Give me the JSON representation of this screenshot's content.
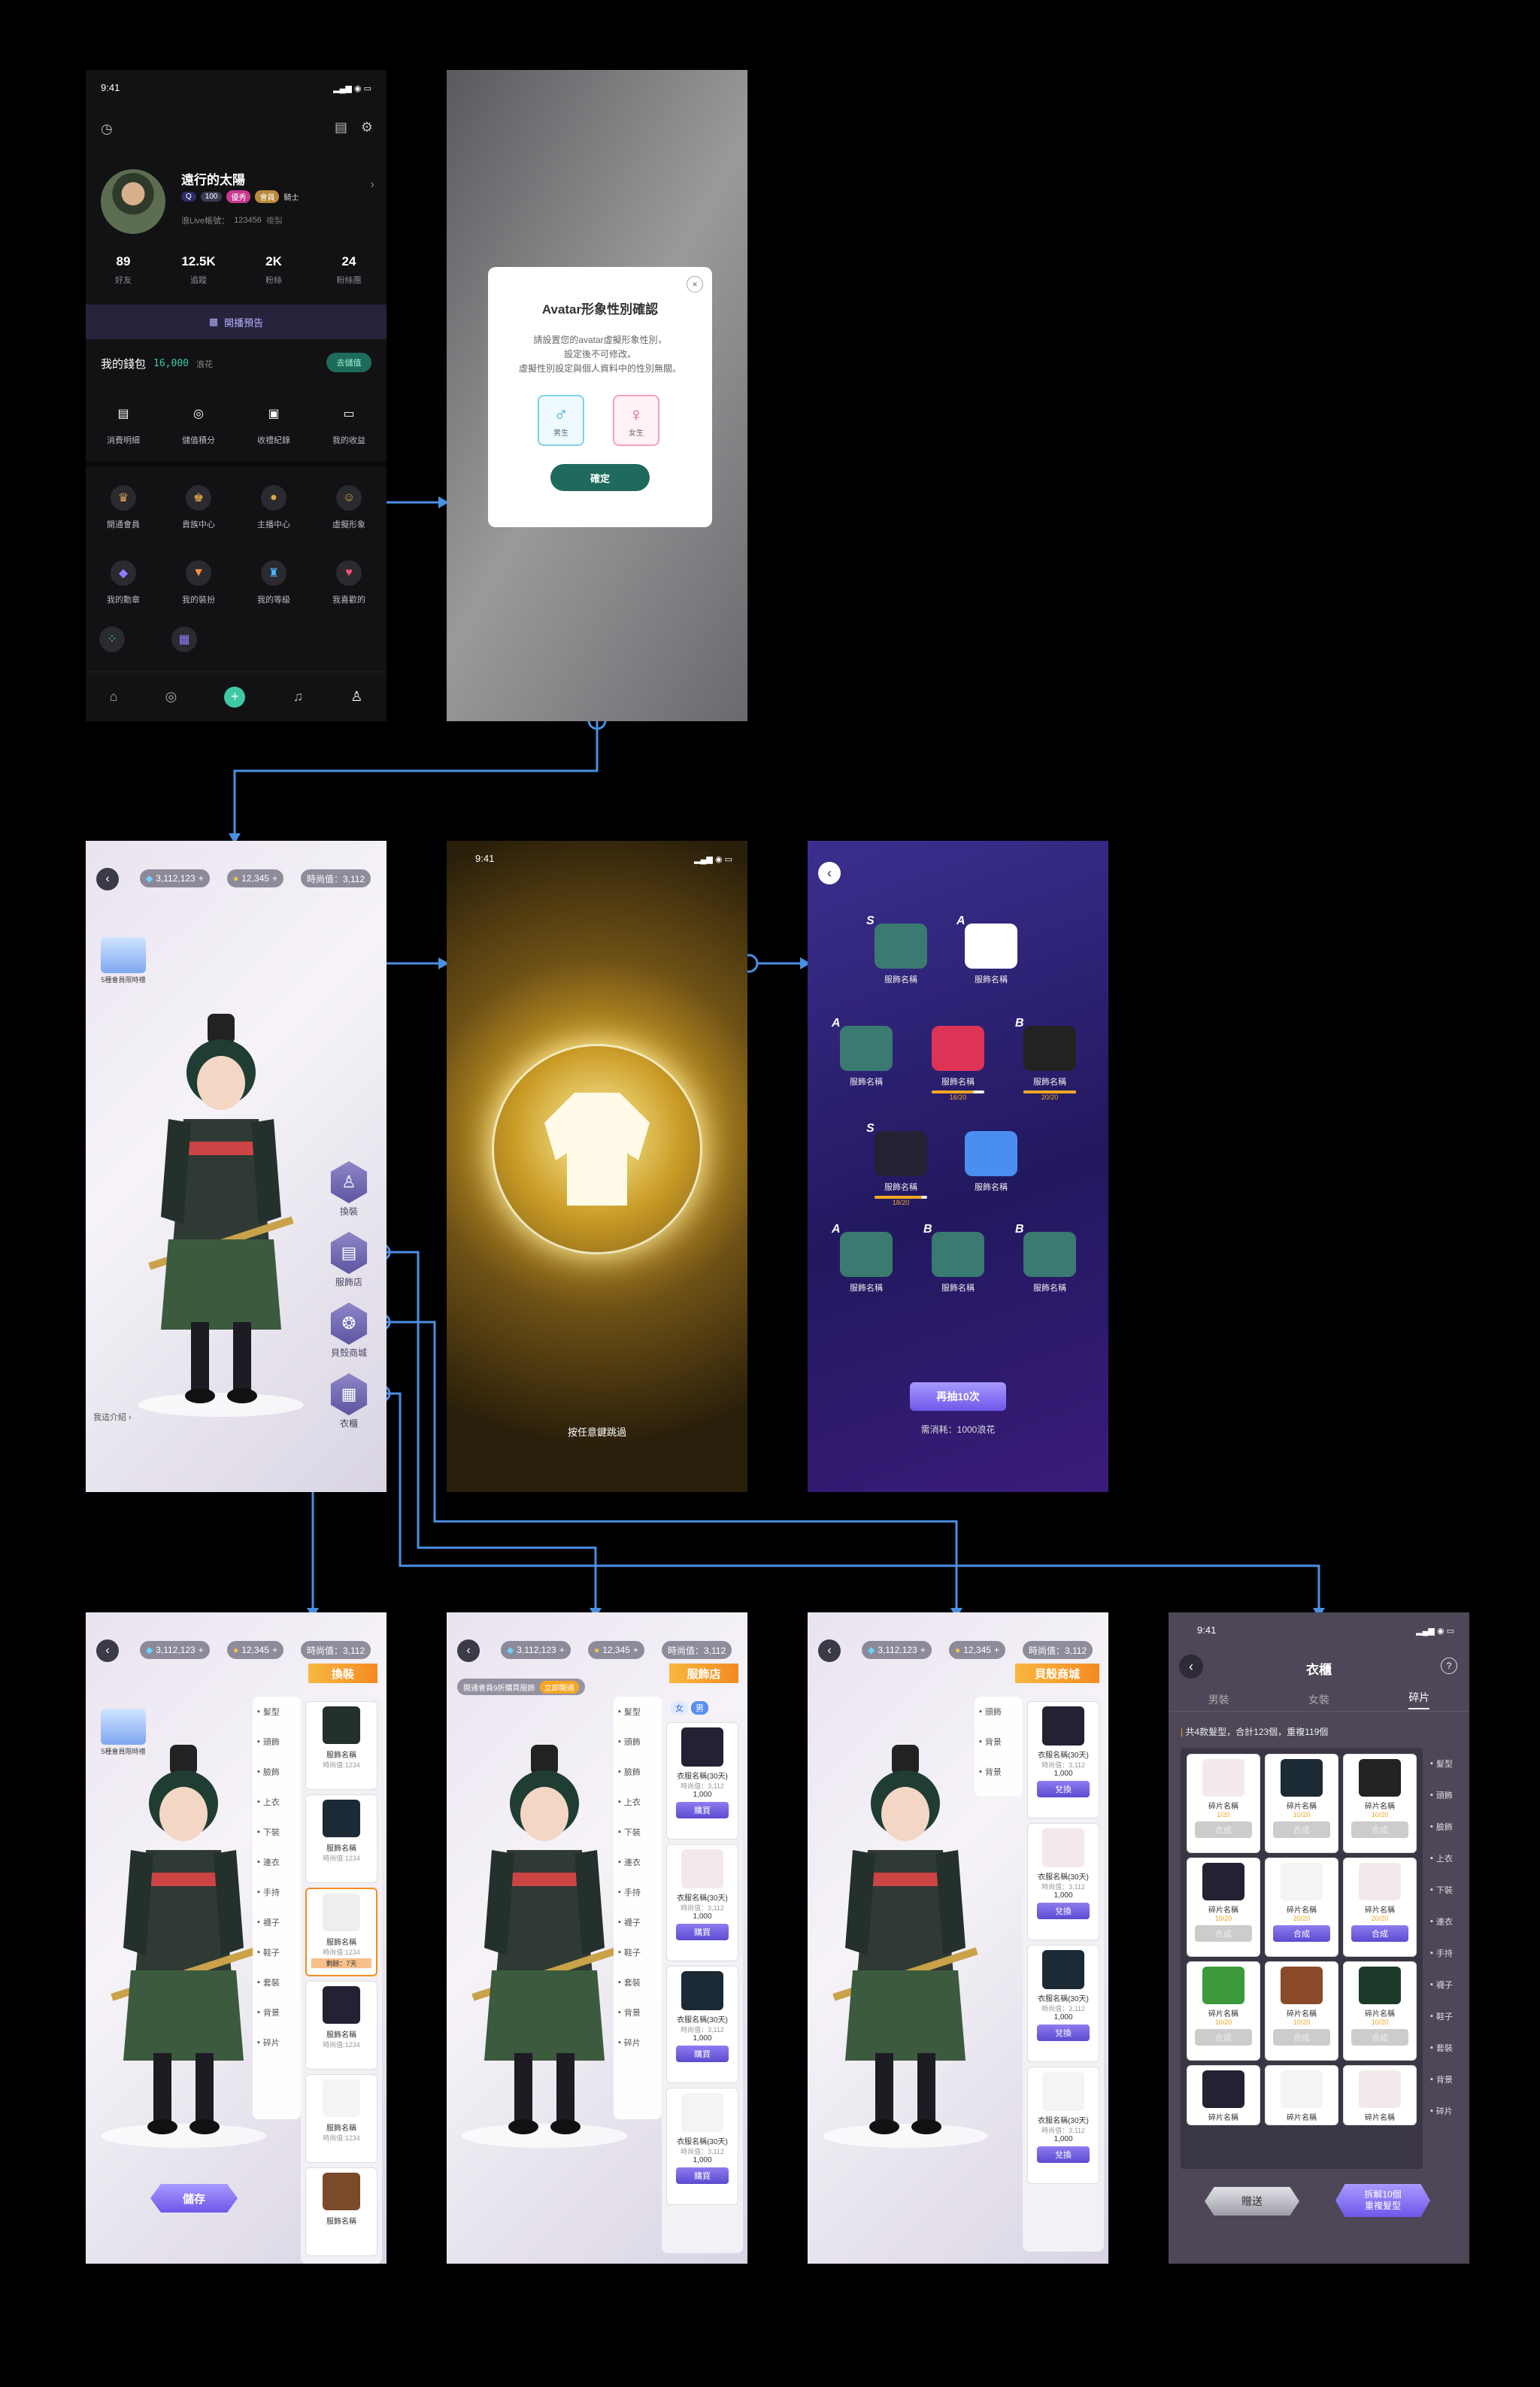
{
  "profile": {
    "time": "9:41",
    "name": "遠行的太陽",
    "level": "100",
    "badge1": "優秀",
    "badge2": "會員",
    "badge3": "騎士",
    "uid_label": "浪Live帳號：",
    "uid": "123456",
    "copy": "複製",
    "stats": [
      {
        "n": "89",
        "l": "好友"
      },
      {
        "n": "12.5K",
        "l": "追蹤"
      },
      {
        "n": "2K",
        "l": "粉絲"
      },
      {
        "n": "24",
        "l": "粉絲團"
      }
    ],
    "live_notice": "開播預告",
    "wallet_label": "我的錢包",
    "wallet_value": "16,000",
    "wallet_unit": "浪花",
    "topup": "去儲值",
    "wallet_items": [
      "消費明細",
      "儲值積分",
      "收禮紀錄",
      "我的收益"
    ],
    "menu_row1": [
      "開通會員",
      "貴族中心",
      "主播中心",
      "虛擬形象"
    ],
    "menu_row2": [
      "我的勳章",
      "我的裝扮",
      "我的等級",
      "我喜歡的"
    ]
  },
  "dialog": {
    "title": "Avatar形象性別確認",
    "text1": "請設置您的avatar虛擬形象性別，",
    "text2": "設定後不可修改。",
    "text3": "虛擬性別設定與個人資料中的性別無關。",
    "male": "男生",
    "female": "女生",
    "confirm": "確定"
  },
  "avatar": {
    "diamond": "3,112,123",
    "gold": "12,345",
    "fashion": "時尚值：3,112",
    "gift_label": "5種會員限時禮",
    "menu": [
      "換裝",
      "服飾店",
      "貝殼商城",
      "衣櫃"
    ],
    "intro": "我這介紹"
  },
  "gacha": {
    "time": "9:41",
    "skip": "按任意鍵跳過"
  },
  "results": {
    "items": [
      {
        "g": "S",
        "n": "服飾名稱"
      },
      {
        "g": "A",
        "n": "服飾名稱"
      },
      {
        "g": "A",
        "n": "服飾名稱"
      },
      {
        "g": "",
        "n": "服飾名稱",
        "p": "16/20"
      },
      {
        "g": "B",
        "n": "服飾名稱",
        "p": "20/20"
      },
      {
        "g": "S",
        "n": "服飾名稱",
        "p": "18/20"
      },
      {
        "g": "",
        "n": "服飾名稱"
      },
      {
        "g": "A",
        "n": "服飾名稱"
      },
      {
        "g": "B",
        "n": "服飾名稱"
      },
      {
        "g": "B",
        "n": "服飾名稱"
      }
    ],
    "again": "再抽10次",
    "cost": "需消耗：1000浪花"
  },
  "dressup": {
    "title": "換裝",
    "save": "儲存",
    "cats": [
      "髮型",
      "頭飾",
      "臉飾",
      "上衣",
      "下裝",
      "連衣",
      "手持",
      "襪子",
      "鞋子",
      "套裝",
      "背景",
      "碎片"
    ],
    "items": [
      {
        "n": "服飾名稱",
        "v": "時尚值:1234"
      },
      {
        "n": "服飾名稱",
        "v": "時尚值:1234"
      },
      {
        "n": "服飾名稱",
        "v": "時尚值:1234",
        "r": "剩餘：7天"
      },
      {
        "n": "服飾名稱",
        "v": "時尚值:1234"
      },
      {
        "n": "服飾名稱",
        "v": "時尚值:1234"
      },
      {
        "n": "服飾名稱"
      }
    ]
  },
  "shop": {
    "title": "服飾店",
    "banner": "開通會員9折購買服飾",
    "banner_btn": "立即開通",
    "female": "女",
    "male": "男",
    "cats": [
      "髮型",
      "頭飾",
      "臉飾",
      "上衣",
      "下裝",
      "連衣",
      "手持",
      "襪子",
      "鞋子",
      "套裝",
      "背景",
      "碎片"
    ],
    "items": [
      {
        "n": "衣服名稱(30天)",
        "v": "時尚值：3,112",
        "p": "1,000",
        "b": "購買"
      },
      {
        "n": "衣服名稱(30天)",
        "v": "時尚值：3,112",
        "p": "1,000",
        "b": "購買"
      },
      {
        "n": "衣服名稱(30天)",
        "v": "時尚值：3,112",
        "p": "1,000",
        "b": "購買"
      },
      {
        "n": "衣服名稱(30天)",
        "v": "時尚值：3,112",
        "p": "1,000",
        "b": "購買"
      }
    ]
  },
  "shell": {
    "title": "貝殼商城",
    "cats": [
      "頭飾",
      "背景",
      "背景"
    ],
    "items": [
      {
        "n": "衣服名稱(30天)",
        "v": "時尚值：3,112",
        "p": "1,000",
        "b": "兌換"
      },
      {
        "n": "衣服名稱(30天)",
        "v": "時尚值：3,112",
        "p": "1,000",
        "b": "兌換"
      },
      {
        "n": "衣服名稱(30天)",
        "v": "時尚值：3,112",
        "p": "1,000",
        "b": "兌換"
      },
      {
        "n": "衣服名稱(30天)",
        "v": "時尚值：3,112",
        "p": "1,000",
        "b": "兌換"
      }
    ]
  },
  "wardrobe": {
    "time": "9:41",
    "title": "衣櫃",
    "tabs": [
      "男裝",
      "女裝",
      "碎片"
    ],
    "summary": "共4款髮型，合計123個，重複119個",
    "cats": [
      "髮型",
      "頭飾",
      "臉飾",
      "上衣",
      "下裝",
      "連衣",
      "手持",
      "襪子",
      "鞋子",
      "套裝",
      "背景",
      "碎片"
    ],
    "cells": [
      {
        "n": "碎片名稱",
        "c": "1/20",
        "b": "合成"
      },
      {
        "n": "碎片名稱",
        "c": "10/20",
        "b": "合成"
      },
      {
        "n": "碎片名稱",
        "c": "10/20",
        "b": "合成"
      },
      {
        "n": "碎片名稱",
        "c": "10/20",
        "b": "合成"
      },
      {
        "n": "碎片名稱",
        "c": "20/20",
        "b": "合成"
      },
      {
        "n": "碎片名稱",
        "c": "20/20",
        "b": "合成"
      },
      {
        "n": "碎片名稱",
        "c": "10/20",
        "b": "合成"
      },
      {
        "n": "碎片名稱",
        "c": "10/20",
        "b": "合成"
      },
      {
        "n": "碎片名稱",
        "c": "10/20",
        "b": "合成"
      },
      {
        "n": "碎片名稱",
        "c": "",
        "b": ""
      },
      {
        "n": "碎片名稱",
        "c": "",
        "b": ""
      },
      {
        "n": "碎片名稱",
        "c": "",
        "b": ""
      }
    ],
    "gift": "贈送",
    "decompose1": "拆解10個",
    "decompose2": "重複髮型"
  }
}
